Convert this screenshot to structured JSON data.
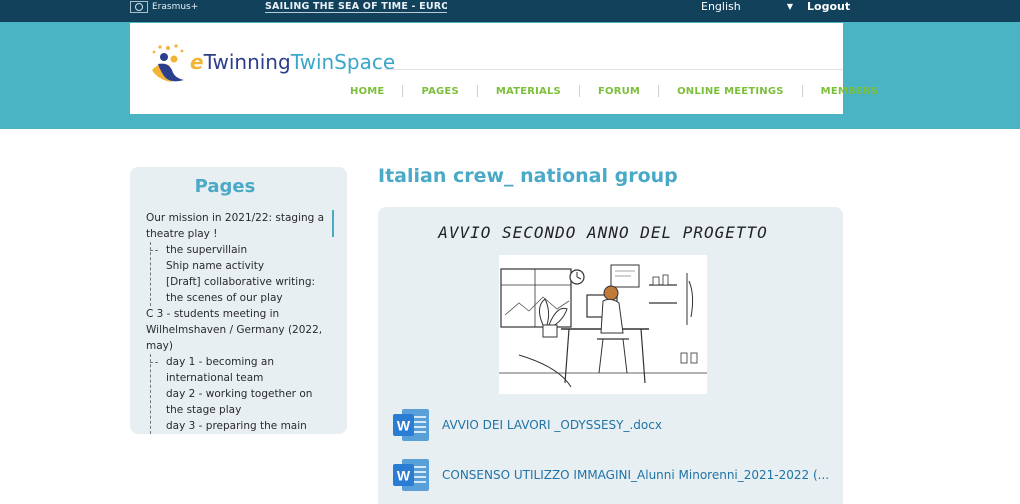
{
  "topbar": {
    "program": "Erasmus+",
    "project_select": "SAILING THE SEA OF TIME - EUROP...",
    "language": "English",
    "logout": "Logout"
  },
  "header": {
    "logo": {
      "e": "e",
      "twinning": "Twinning",
      "twinspace": "TwinSpace"
    },
    "nav": [
      "HOME",
      "PAGES",
      "MATERIALS",
      "FORUM",
      "ONLINE MEETINGS",
      "MEMBERS"
    ]
  },
  "sidebar": {
    "title": "Pages",
    "items": [
      {
        "level": 0,
        "label": "Our mission in 2021/22: staging a theatre play !"
      },
      {
        "level": 1,
        "label": "the supervillain"
      },
      {
        "level": 1,
        "label": "Ship name activity"
      },
      {
        "level": 1,
        "label": "[Draft] collaborative writing: the scenes of our play"
      },
      {
        "level": 0,
        "label": "C 3 - students meeting in Wilhelmshaven / Germany (2022, may)"
      },
      {
        "level": 1,
        "label": "day 1 - becoming an international team"
      },
      {
        "level": 1,
        "label": "day 2 - working together on the stage play"
      },
      {
        "level": 1,
        "label": "day 3 - preparing the main"
      }
    ]
  },
  "main": {
    "page_title": "Italian crew_ national group",
    "heading": "AVVIO SECONDO ANNO DEL PROGETTO",
    "files": [
      {
        "name": "AVVIO DEI LAVORI _ODYSSESY_.docx",
        "icon": "word-doc-icon"
      },
      {
        "name": "CONSENSO UTILIZZO IMMAGINI_Alunni Minorenni_2021-2022 (...",
        "icon": "word-doc-icon"
      }
    ]
  },
  "colors": {
    "topbar": "#12415c",
    "band": "#4ab3c4",
    "accent": "#4aa9c7",
    "nav": "#7bbf3a",
    "link": "#1f73a6",
    "panel": "#e8eff2"
  }
}
